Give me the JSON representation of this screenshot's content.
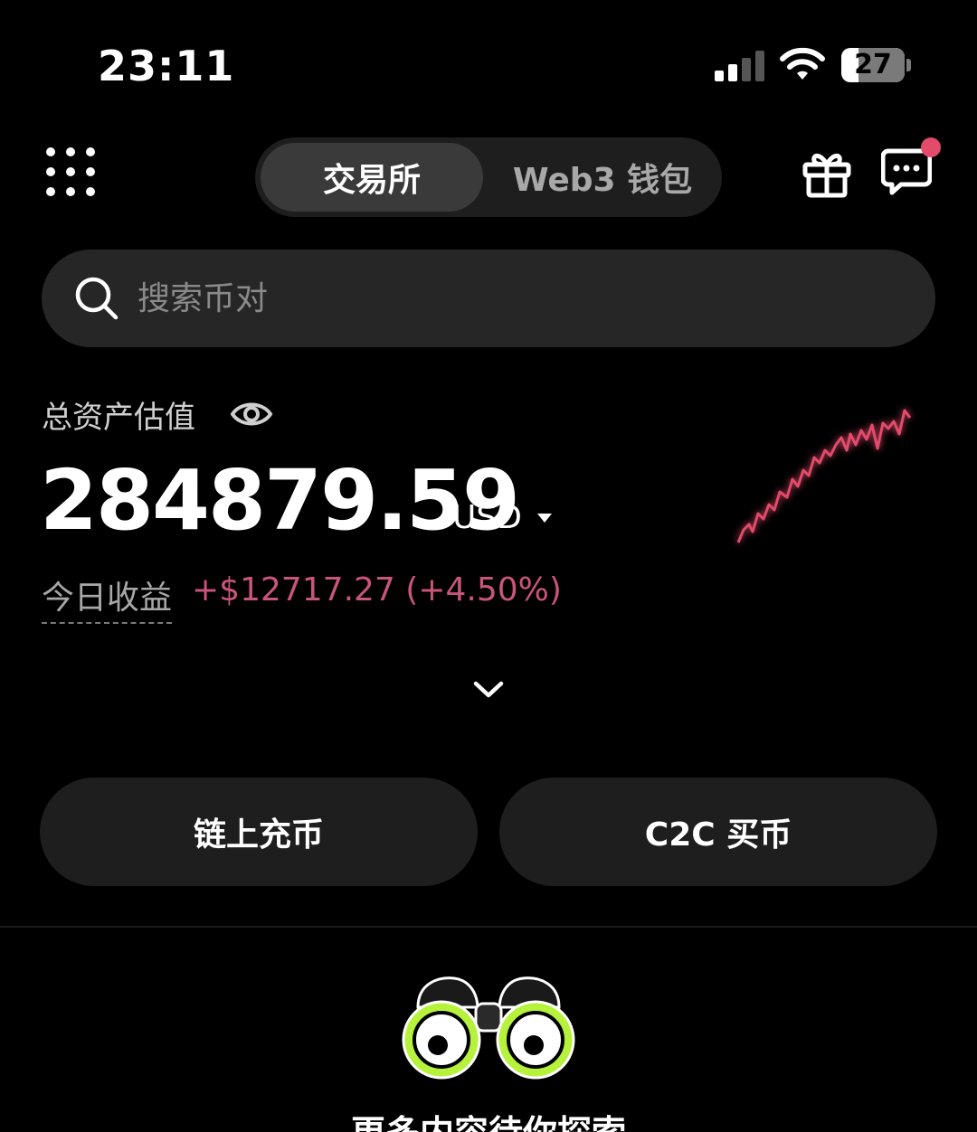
{
  "status_bar": {
    "time": "23:11",
    "battery": "27",
    "battery_level": 0.27,
    "signal_bars": 2
  },
  "header": {
    "tabs": [
      {
        "label": "交易所",
        "active": true
      },
      {
        "label": "Web3 钱包",
        "active": false
      }
    ],
    "has_notification": true,
    "icons": [
      "grid-menu-icon",
      "gift-icon",
      "message-icon"
    ]
  },
  "search": {
    "placeholder": "搜索币对"
  },
  "assets": {
    "label": "总资产估值",
    "value": "284879.59",
    "currency": "USD",
    "pnl_label": "今日收益",
    "pnl_value": "+$12717.27 (+4.50%)"
  },
  "actions": {
    "deposit": "链上充币",
    "c2c": "C2C 买币"
  },
  "explore": {
    "text": "更多内容待你探索"
  },
  "colors": {
    "accent_pink": "#e34b6b",
    "pnl_color": "#c8557a",
    "binocular_green": "#b6f23b",
    "card_bg": "#1e1e1e"
  }
}
